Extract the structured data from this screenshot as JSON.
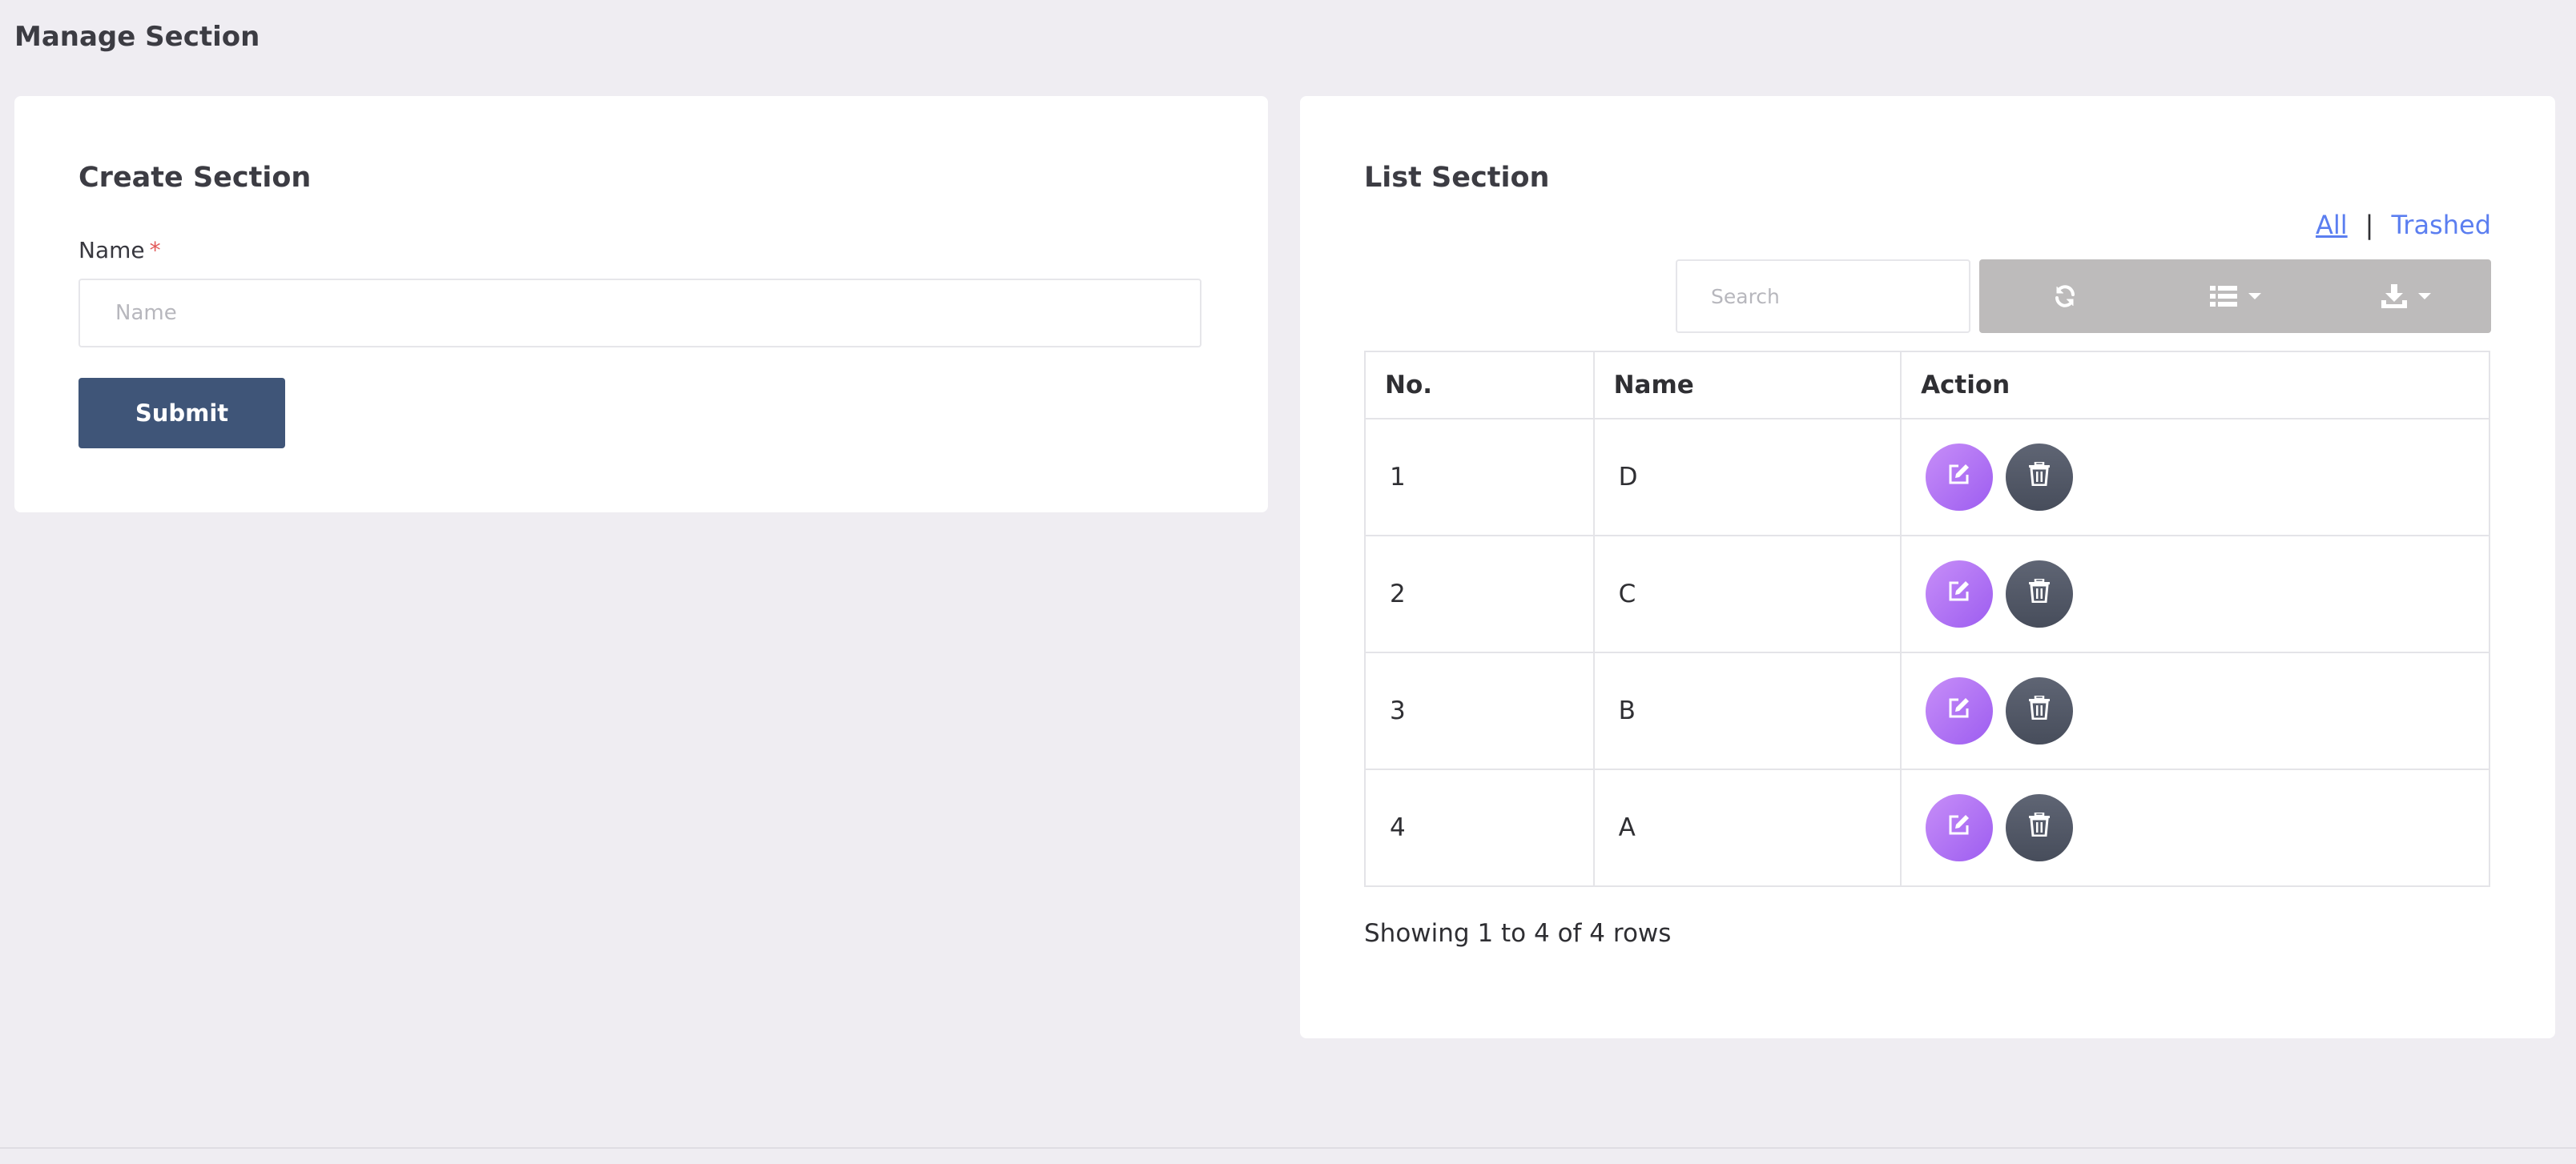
{
  "page": {
    "title": "Manage Section"
  },
  "create_section": {
    "title": "Create Section",
    "name_label": "Name",
    "required_mark": "*",
    "name_placeholder": "Name",
    "name_value": "",
    "submit_label": "Submit"
  },
  "list_section": {
    "title": "List Section",
    "filters": {
      "all_label": "All",
      "separator": "|",
      "trashed_label": "Trashed",
      "active": "All"
    },
    "search": {
      "placeholder": "Search",
      "value": ""
    },
    "toolbar": {
      "refresh_icon": "refresh-icon",
      "columns_icon": "list-columns-icon",
      "export_icon": "download-icon"
    },
    "table": {
      "headers": [
        "No.",
        "Name",
        "Action"
      ],
      "rows": [
        {
          "no": "1",
          "name": "D"
        },
        {
          "no": "2",
          "name": "C"
        },
        {
          "no": "3",
          "name": "B"
        },
        {
          "no": "4",
          "name": "A"
        }
      ]
    },
    "pagination_text": "Showing 1 to 4 of 4 rows"
  },
  "colors": {
    "background": "#efedf2",
    "card": "#ffffff",
    "submit_button": "#3f5578",
    "toolbar": "#bdbbbb",
    "edit_button": "#b07bf5",
    "delete_button": "#525867",
    "link": "#5b7ef0",
    "required": "#e25a5a"
  }
}
